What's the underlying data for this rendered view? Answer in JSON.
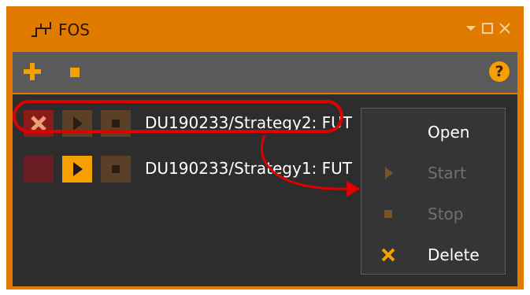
{
  "window": {
    "title": "FOS",
    "icon": "strategy-icon"
  },
  "title_controls": [
    {
      "name": "dropdown-icon"
    },
    {
      "name": "maximize-icon"
    },
    {
      "name": "close-icon"
    }
  ],
  "toolbar": {
    "add_icon": "plus-icon",
    "stop_icon": "stop-icon",
    "help_label": "?"
  },
  "strategies": [
    {
      "label": "DU190233/Strategy2: FUT",
      "state": "stopped"
    },
    {
      "label": "DU190233/Strategy1: FUT",
      "state": "stopped"
    }
  ],
  "context_menu": {
    "items": [
      {
        "label": "Open",
        "icon": "",
        "enabled": true
      },
      {
        "label": "Start",
        "icon": "play-icon",
        "enabled": false
      },
      {
        "label": "Stop",
        "icon": "stop-icon",
        "enabled": false
      },
      {
        "label": "Delete",
        "icon": "delete-icon",
        "enabled": true
      }
    ]
  },
  "colors": {
    "accent": "#f5a000",
    "window": "#e07b00",
    "panel": "#2d2d2d",
    "annotation": "#e00000",
    "disabled_text": "#707070"
  }
}
